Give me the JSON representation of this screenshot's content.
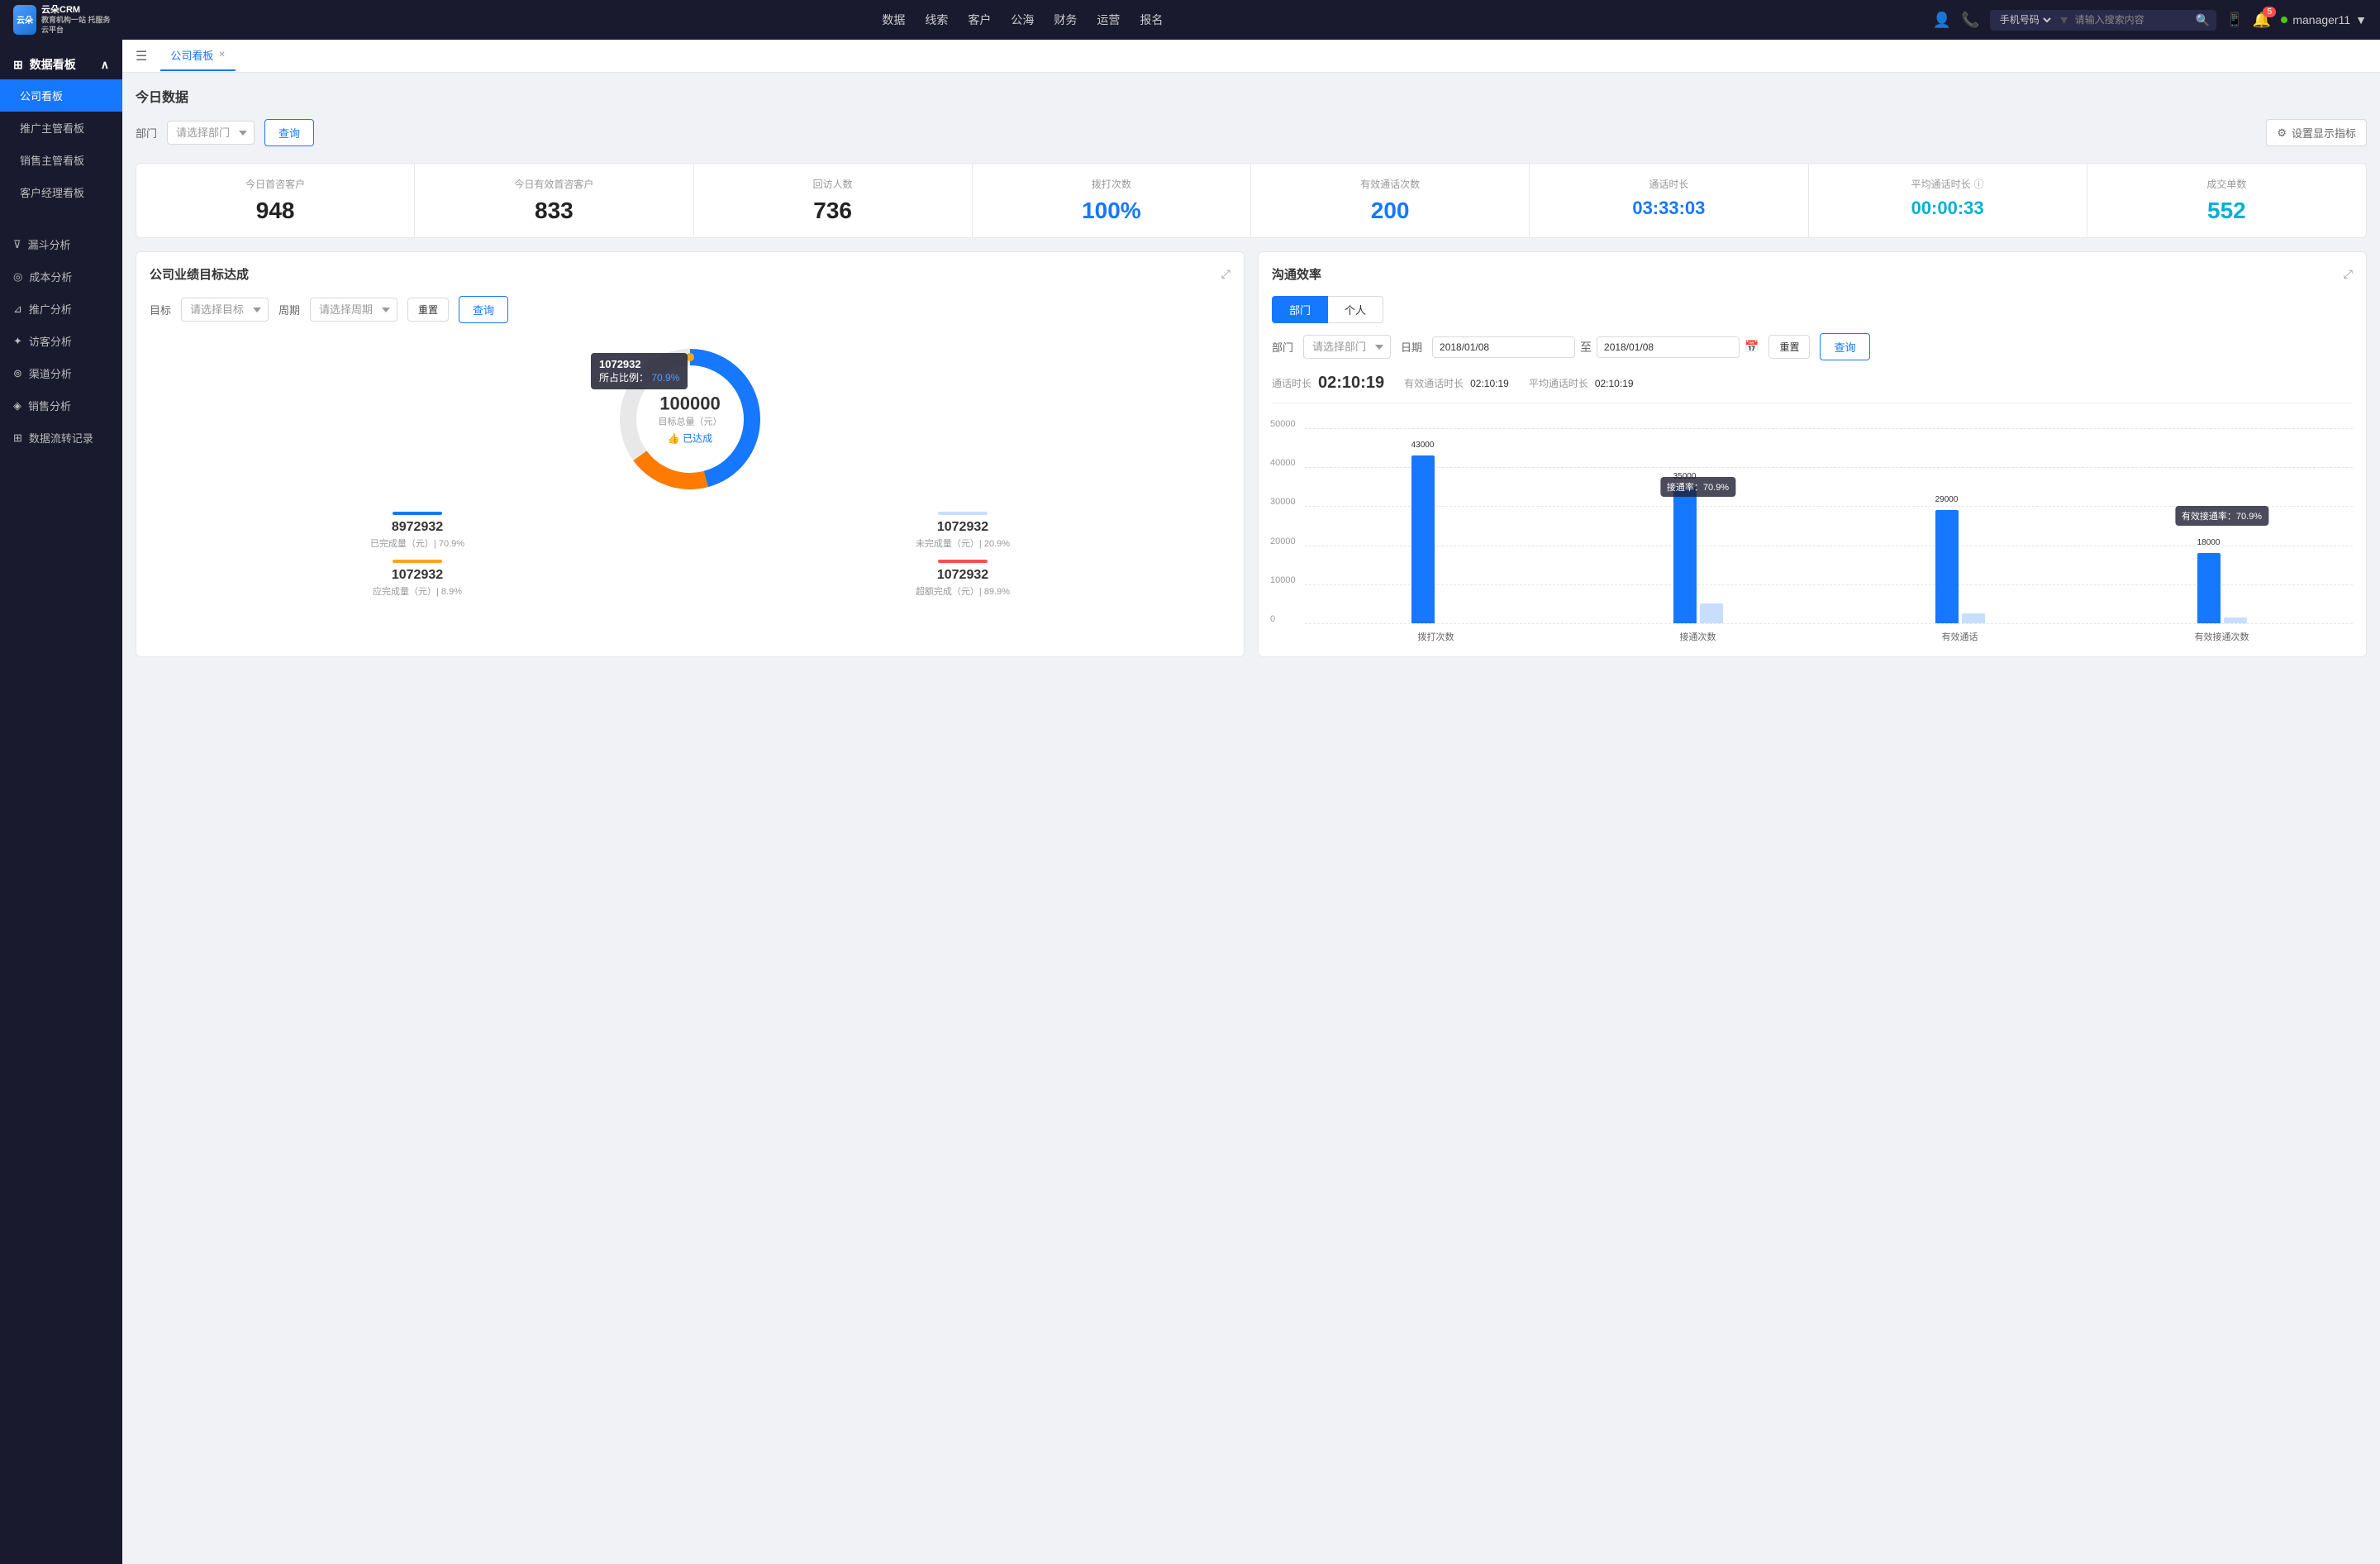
{
  "topNav": {
    "logo": "云朵CRM",
    "logoSub": "教育机构一站\n托服务云平台",
    "items": [
      "数据",
      "线索",
      "客户",
      "公海",
      "财务",
      "运营",
      "报名"
    ],
    "searchPlaceholder": "请输入搜索内容",
    "searchType": "手机号码",
    "badgeCount": "5",
    "username": "manager11"
  },
  "sidebar": {
    "sectionTitle": "数据看板",
    "items": [
      {
        "label": "公司看板",
        "active": true
      },
      {
        "label": "推广主管看板",
        "active": false
      },
      {
        "label": "销售主管看板",
        "active": false
      },
      {
        "label": "客户经理看板",
        "active": false
      }
    ],
    "analysisItems": [
      {
        "label": "漏斗分析",
        "icon": "filter"
      },
      {
        "label": "成本分析",
        "icon": "cost"
      },
      {
        "label": "推广分析",
        "icon": "promote"
      },
      {
        "label": "访客分析",
        "icon": "visitor"
      },
      {
        "label": "渠道分析",
        "icon": "channel"
      },
      {
        "label": "销售分析",
        "icon": "sales"
      },
      {
        "label": "数据流转记录",
        "icon": "record"
      }
    ]
  },
  "tabs": [
    {
      "label": "公司看板",
      "active": true
    }
  ],
  "todayData": {
    "title": "今日数据",
    "filterLabel": "部门",
    "filterPlaceholder": "请选择部门",
    "queryBtn": "查询",
    "settingsBtn": "设置显示指标",
    "stats": [
      {
        "label": "今日首咨客户",
        "value": "948",
        "color": "black"
      },
      {
        "label": "今日有效首咨客户",
        "value": "833",
        "color": "black"
      },
      {
        "label": "回访人数",
        "value": "736",
        "color": "black"
      },
      {
        "label": "拨打次数",
        "value": "100%",
        "color": "blue"
      },
      {
        "label": "有效通话次数",
        "value": "200",
        "color": "blue"
      },
      {
        "label": "通话时长",
        "value": "03:33:03",
        "color": "blue"
      },
      {
        "label": "平均通话时长",
        "value": "00:00:33",
        "color": "cyan"
      },
      {
        "label": "成交单数",
        "value": "552",
        "color": "cyan"
      }
    ]
  },
  "goalPanel": {
    "title": "公司业绩目标达成",
    "goalLabel": "目标",
    "goalPlaceholder": "请选择目标",
    "periodLabel": "周期",
    "periodPlaceholder": "请选择周期",
    "resetBtn": "重置",
    "queryBtn": "查询",
    "donut": {
      "tooltip": {
        "value": "1072932",
        "percentLabel": "所占比例：",
        "percent": "70.9%"
      },
      "centerValue": "100000",
      "centerLabel": "目标总量（元）",
      "centerBadge": "👍 已达成"
    },
    "stats": [
      {
        "label": "已完成量（元）| 70.9%",
        "value": "8972932",
        "barColor": "#1677ff"
      },
      {
        "label": "未完成量（元）| 20.9%",
        "value": "1072932",
        "barColor": "#c8deff"
      },
      {
        "label": "应完成量（元）| 8.9%",
        "value": "1072932",
        "barColor": "#f5a623"
      },
      {
        "label": "超额完成（元）| 89.9%",
        "value": "1072932",
        "barColor": "#ff4d4f"
      }
    ]
  },
  "commPanel": {
    "title": "沟通效率",
    "tabs": [
      "部门",
      "个人"
    ],
    "activeTab": "部门",
    "deptLabel": "部门",
    "deptPlaceholder": "请选择部门",
    "dateLabel": "日期",
    "dateFrom": "2018/01/08",
    "dateTo": "2018/01/08",
    "resetBtn": "重置",
    "queryBtn": "查询",
    "stats": {
      "callDuration": {
        "label": "通话时长",
        "value": "02:10:19"
      },
      "effectiveDuration": {
        "label": "有效通话时长",
        "value": "02:10:19"
      },
      "avgDuration": {
        "label": "平均通话时长",
        "value": "02:10:19"
      }
    },
    "chart": {
      "yLabels": [
        "50000",
        "40000",
        "30000",
        "20000",
        "10000",
        "0"
      ],
      "xLabels": [
        "拨打次数",
        "接通次数",
        "有效通话",
        "有效接通次数"
      ],
      "bars": [
        {
          "tall": 43000,
          "short": null,
          "tallLabel": "43000",
          "shortLabel": null,
          "annotation": null
        },
        {
          "tall": 35000,
          "short": null,
          "tallLabel": "35000",
          "shortLabel": null,
          "annotation": "接通率：70.9%"
        },
        {
          "tall": 29000,
          "short": null,
          "tallLabel": "29000",
          "shortLabel": null,
          "annotation": null
        },
        {
          "tall": 18000,
          "short": null,
          "tallLabel": "18000",
          "shortLabel": null,
          "annotation": "有效接通率：70.9%"
        }
      ]
    }
  }
}
